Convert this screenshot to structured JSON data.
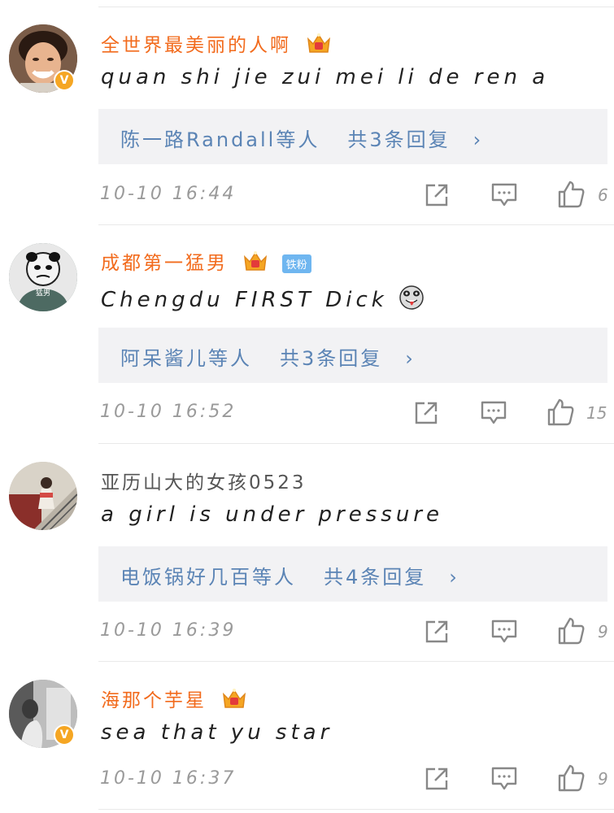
{
  "comments": [
    {
      "username": "全世界最美丽的人啊",
      "text": "quan shi jie zui mei li de ren a",
      "reply": {
        "names": "陈一路Randall等人",
        "count": "共3条回复",
        "chevron": "›"
      },
      "timestamp": "10-10 16:44",
      "likes": "6",
      "username_color": "#f26b1d",
      "verified": true
    },
    {
      "username": "成都第一猛男",
      "badge": "铁粉",
      "text": "Chengdu FIRST Dick",
      "reply": {
        "names": "阿呆酱儿等人",
        "count": "共3条回复",
        "chevron": "›"
      },
      "timestamp": "10-10 16:52",
      "likes": "15",
      "username_color": "#f26b1d",
      "verified": false
    },
    {
      "username": "亚历山大的女孩0523",
      "text": "a girl is under pressure",
      "reply": {
        "names": "电饭锅好几百等人",
        "count": "共4条回复",
        "chevron": "›"
      },
      "timestamp": "10-10 16:39",
      "likes": "9",
      "username_color": "#555555",
      "verified": false
    },
    {
      "username": "海那个芋星",
      "text": "sea that yu star",
      "timestamp": "10-10 16:37",
      "likes": "9",
      "username_color": "#f26b1d",
      "verified": true
    }
  ],
  "avatar_meme_text": "猛男",
  "verified_badge_glyph": "V",
  "icons": [
    "crown-icon",
    "share-icon",
    "comment-icon",
    "like-icon",
    "chevron-right-icon",
    "emoji-icon"
  ]
}
